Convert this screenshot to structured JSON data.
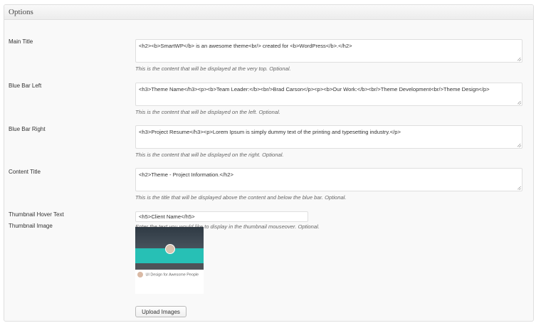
{
  "panel": {
    "title": "Options"
  },
  "fields": [
    {
      "label": "Main Title",
      "value": "<h2><b>SmartWP</b> is an awesome theme<br/> created for <b>WordPress</b>.</h2>",
      "description": "This is the content that will be displayed at the very top. Optional."
    },
    {
      "label": "Blue Bar Left",
      "value": "<h3>Theme Name</h3><p><b>Team Leader:</b><br/>Brad Carson</p><p><b>Our Work:</b><br/>Theme Development<br/>Theme Design</p>",
      "description": "This is the content that will be displayed on the left. Optional."
    },
    {
      "label": "Blue Bar Right",
      "value": "<h3>Project Resume</h3><p>Lorem Ipsum is simply dummy text of the printing and typesetting industry.</p>",
      "description": "This is the content that will be displayed on the right. Optional."
    },
    {
      "label": "Content Title",
      "value": "<h2>Theme - Project Information.</h2>",
      "description": "This is the title that will be displayed above the content and below the blue bar. Optional."
    }
  ],
  "hover": {
    "label": "Thumbnail Hover Text",
    "value": "<h5>Client Name</h5>",
    "description": "Enter the text you would like to display in the thumbnail mouseover. Optional."
  },
  "thumbnail": {
    "label": "Thumbnail Image",
    "caption": "UI Design for Awesome People",
    "button_label": "Upload Images"
  }
}
